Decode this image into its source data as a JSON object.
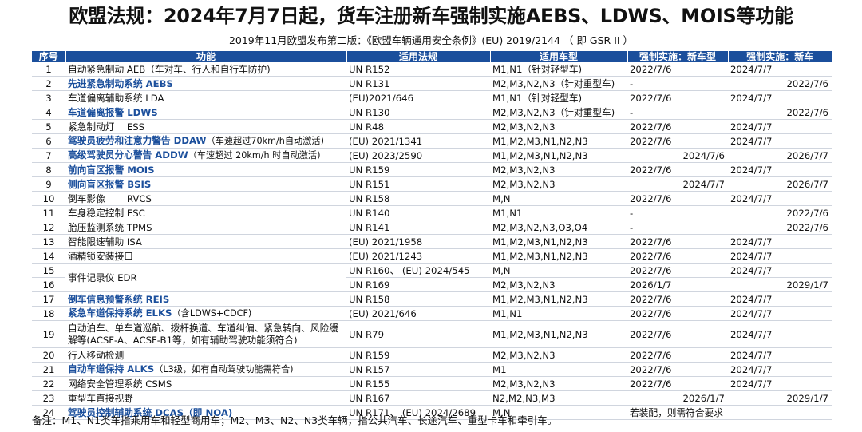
{
  "title": "欧盟法规：2024年7月7日起，货车注册新车强制实施AEBS、LDWS、MOIS等功能",
  "subtitle": "2019年11月欧盟发布第二版：《欧盟车辆通用安全条例》(EU) 2019/2144 （ 即 GSR II ）",
  "columns": [
    "序号",
    "功能",
    "适用法规",
    "适用车型",
    "强制实施：新车型",
    "强制实施：新车"
  ],
  "rows": [
    {
      "no": "1",
      "fn": "自动紧急制动 AEB（车对车、行人和自行车防护)",
      "note": "",
      "hl": false,
      "reg": "UN R152",
      "types": "M1,N1（针对轻型车)",
      "nt": "2022/7/6",
      "nv": "2024/7/7"
    },
    {
      "no": "2",
      "fn": "先进紧急制动系统 AEBS",
      "note": "",
      "hl": true,
      "reg": "UN R131",
      "types": "M2,M3,N2,N3（针对重型车)",
      "nt": "-",
      "nv": "2022/7/6"
    },
    {
      "no": "3",
      "fn": "车道偏离辅助系统 LDA",
      "note": "",
      "hl": false,
      "reg": "(EU)2021/646",
      "types": "M1,N1（针对轻型车)",
      "nt": "2022/7/6",
      "nv": "2024/7/7"
    },
    {
      "no": "4",
      "fn": "车道偏离报警 LDWS",
      "note": "",
      "hl": true,
      "reg": "UN R130",
      "types": "M2,M3,N2,N3（针对重型车)",
      "nt": "-",
      "nv": "2022/7/6"
    },
    {
      "no": "5",
      "fn": "紧急制动灯　 ESS",
      "note": "",
      "hl": false,
      "reg": "UN R48",
      "types": "M2,M3,N2,N3",
      "nt": "2022/7/6",
      "nv": "2024/7/7"
    },
    {
      "no": "6",
      "fn": "驾驶员疲劳和注意力警告 DDAW",
      "note": "（车速超过70km/h自动激活)",
      "hl": true,
      "reg": "(EU) 2021/1341",
      "types": "M1,M2,M3,N1,N2,N3",
      "nt": "2022/7/6",
      "nv": "2024/7/7"
    },
    {
      "no": "7",
      "fn": "高级驾驶员分心警告 ADDW",
      "note": "（车速超过 20km/h 时自动激活)",
      "hl": true,
      "reg": "(EU) 2023/2590",
      "types": "M1,M2,M3,N1,N2,N3",
      "nt": "2024/7/6",
      "nv": "2026/7/7"
    },
    {
      "no": "8",
      "fn": "前向盲区报警 MOIS",
      "note": "",
      "hl": true,
      "reg": "UN R159",
      "types": "M2,M3,N2,N3",
      "nt": "2022/7/6",
      "nv": "2024/7/7"
    },
    {
      "no": "9",
      "fn": "侧向盲区报警 BSIS",
      "note": "",
      "hl": true,
      "reg": "UN R151",
      "types": "M2,M3,N2,N3",
      "nt": "2024/7/7",
      "nv": "2026/7/7"
    },
    {
      "no": "10",
      "fn": "倒车影像　　 RVCS",
      "note": "",
      "hl": false,
      "reg": "UN R158",
      "types": "M,N",
      "nt": "2022/7/6",
      "nv": "2024/7/7"
    },
    {
      "no": "11",
      "fn": "车身稳定控制 ESC",
      "note": "",
      "hl": false,
      "reg": "UN R140",
      "types": "M1,N1",
      "nt": "-",
      "nv": "2022/7/6"
    },
    {
      "no": "12",
      "fn": "胎压监测系统 TPMS",
      "note": "",
      "hl": false,
      "reg": "UN R141",
      "types": "M2,M3,N2,N3,O3,O4",
      "nt": "-",
      "nv": "2022/7/6"
    },
    {
      "no": "13",
      "fn": "智能限速辅助 ISA",
      "note": "",
      "hl": false,
      "reg": "(EU) 2021/1958",
      "types": "M1,M2,M3,N1,N2,N3",
      "nt": "2022/7/6",
      "nv": "2024/7/7"
    },
    {
      "no": "14",
      "fn": "酒精锁安装接口",
      "note": "",
      "hl": false,
      "reg": "(EU) 2021/1243",
      "types": "M1,M2,M3,N1,N2,N3",
      "nt": "2022/7/6",
      "nv": "2024/7/7"
    },
    {
      "no": "15",
      "fn": "事件记录仪 EDR",
      "note": "",
      "hl": false,
      "reg": "UN R160、 (EU) 2024/545",
      "types": "M,N",
      "nt": "2022/7/6",
      "nv": "2024/7/7"
    },
    {
      "no": "16",
      "fn": "",
      "note": "",
      "hl": false,
      "reg": "UN R169",
      "types": "M2,M3,N2,N3",
      "nt": "2026/1/7",
      "nv": "2029/1/7"
    },
    {
      "no": "17",
      "fn": "倒车信息预警系统 REIS",
      "note": "",
      "hl": true,
      "reg": "UN R158",
      "types": "M1,M2,M3,N1,N2,N3",
      "nt": "2022/7/6",
      "nv": "2024/7/7"
    },
    {
      "no": "18",
      "fn": "紧急车道保持系统 ELKS",
      "note": "（含LDWS+CDCF)",
      "hl": true,
      "reg": "(EU) 2021/646",
      "types": "M1,N1",
      "nt": "2022/7/6",
      "nv": "2024/7/7"
    },
    {
      "no": "19",
      "fn": "自动泊车、单车道巡航、拨杆换道、车道纠偏、紧急转向、风险缓解等(ACSF-A、ACSF-B1等，如有辅助驾驶功能须符合)",
      "note": "",
      "hl": false,
      "reg": "UN R79",
      "types": "M1,M2,M3,N1,N2,N3",
      "nt": "2022/7/6",
      "nv": "2024/7/7"
    },
    {
      "no": "20",
      "fn": "行人移动检测",
      "note": "",
      "hl": false,
      "reg": "UN R159",
      "types": "M2,M3,N2,N3",
      "nt": "2022/7/6",
      "nv": "2024/7/7"
    },
    {
      "no": "21",
      "fn": "自动车道保持 ALKS",
      "note": "（L3级，如有自动驾驶功能需符合)",
      "hl": true,
      "reg": "UN R157",
      "types": "M1",
      "nt": "2022/7/6",
      "nv": "2024/7/7"
    },
    {
      "no": "22",
      "fn": "网络安全管理系统 CSMS",
      "note": "",
      "hl": false,
      "reg": "UN R155",
      "types": "M2,M3,N2,N3",
      "nt": "2022/7/6",
      "nv": "2024/7/7"
    },
    {
      "no": "23",
      "fn": "重型车直接视野",
      "note": "",
      "hl": false,
      "reg": "UN R167",
      "types": "N2,M2,N3,M3",
      "nt": "2026/1/7",
      "nv": "2029/1/7"
    },
    {
      "no": "24",
      "fn": "驾驶员控制辅助系统 DCAS（即 NOA)",
      "note": "",
      "hl": true,
      "reg": "UN R171、 (EU) 2024/2689",
      "types": "M,N",
      "nt": "若装配，则需符合要求",
      "nv": ""
    }
  ],
  "footnote": "备注：M1、N1类车指乘用车和轻型商用车；M2、M3、N2、N3类车辆，指公共汽车、长途汽车、重型卡车和牵引车。",
  "colors": {
    "header_bg": "#1b4f9c",
    "highlight_text": "#1b4f9c"
  }
}
